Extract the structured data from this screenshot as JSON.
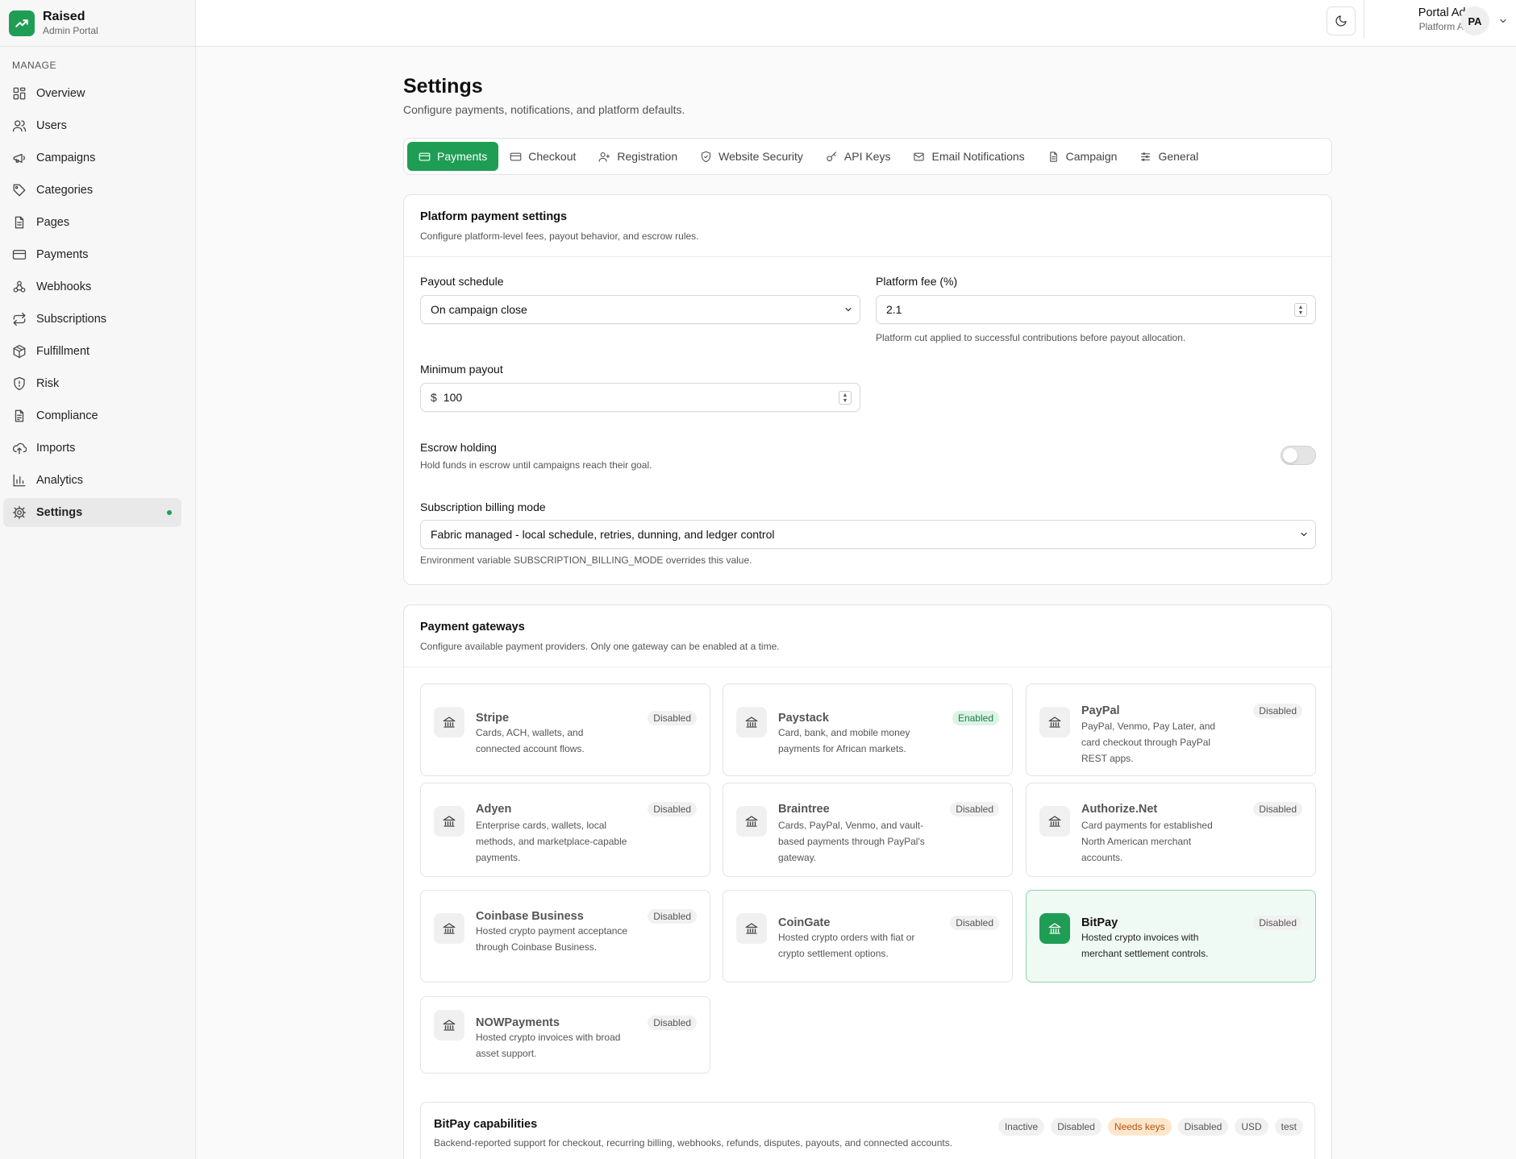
{
  "brand": {
    "name": "Raised",
    "subtitle": "Admin Portal"
  },
  "sidebar": {
    "section_label": "MANAGE",
    "items": [
      {
        "label": "Overview",
        "icon": "grid-icon"
      },
      {
        "label": "Users",
        "icon": "users-icon"
      },
      {
        "label": "Campaigns",
        "icon": "megaphone-icon"
      },
      {
        "label": "Categories",
        "icon": "tag-icon"
      },
      {
        "label": "Pages",
        "icon": "file-icon"
      },
      {
        "label": "Payments",
        "icon": "credit-card-icon"
      },
      {
        "label": "Webhooks",
        "icon": "webhook-icon"
      },
      {
        "label": "Subscriptions",
        "icon": "repeat-icon"
      },
      {
        "label": "Fulfillment",
        "icon": "package-icon"
      },
      {
        "label": "Risk",
        "icon": "shield-icon"
      },
      {
        "label": "Compliance",
        "icon": "document-icon"
      },
      {
        "label": "Imports",
        "icon": "cloud-upload-icon"
      },
      {
        "label": "Analytics",
        "icon": "bar-chart-icon"
      },
      {
        "label": "Settings",
        "icon": "gear-icon",
        "active": true
      }
    ]
  },
  "header": {
    "user_name": "Portal Admin",
    "user_role": "Platform Admin",
    "avatar_initials": "PA"
  },
  "page": {
    "title": "Settings",
    "subtitle": "Configure payments, notifications, and platform defaults."
  },
  "tabs": [
    {
      "label": "Payments",
      "active": true
    },
    {
      "label": "Checkout"
    },
    {
      "label": "Registration"
    },
    {
      "label": "Website Security"
    },
    {
      "label": "API Keys"
    },
    {
      "label": "Email Notifications"
    },
    {
      "label": "Campaign"
    },
    {
      "label": "General"
    }
  ],
  "platform": {
    "title": "Platform payment settings",
    "desc": "Configure platform-level fees, payout behavior, and escrow rules.",
    "payout_label": "Payout schedule",
    "payout_value": "On campaign close",
    "fee_label": "Platform fee (%)",
    "fee_value": "2.1",
    "fee_help": "Platform cut applied to successful contributions before payout allocation.",
    "min_label": "Minimum payout",
    "min_prefix": "$",
    "min_value": "100",
    "escrow_label": "Escrow holding",
    "escrow_help": "Hold funds in escrow until campaigns reach their goal.",
    "escrow_on": false,
    "billing_label": "Subscription billing mode",
    "billing_value": "Fabric managed - local schedule, retries, dunning, and ledger control",
    "billing_help": "Environment variable SUBSCRIPTION_BILLING_MODE overrides this value."
  },
  "gateways": {
    "title": "Payment gateways",
    "desc": "Configure available payment providers. Only one gateway can be enabled at a time.",
    "items": [
      {
        "name": "Stripe",
        "status": "Disabled",
        "desc": "Cards, ACH, wallets, and connected account flows."
      },
      {
        "name": "Paystack",
        "status": "Enabled",
        "desc": "Card, bank, and mobile money payments for African markets."
      },
      {
        "name": "PayPal",
        "status": "Disabled",
        "desc": "PayPal, Venmo, Pay Later, and card checkout through PayPal REST apps."
      },
      {
        "name": "Adyen",
        "status": "Disabled",
        "desc": "Enterprise cards, wallets, local methods, and marketplace-capable payments."
      },
      {
        "name": "Braintree",
        "status": "Disabled",
        "desc": "Cards, PayPal, Venmo, and vault-based payments through PayPal's gateway."
      },
      {
        "name": "Authorize.Net",
        "status": "Disabled",
        "desc": "Card payments for established North American merchant accounts."
      },
      {
        "name": "Coinbase Business",
        "status": "Disabled",
        "desc": "Hosted crypto payment acceptance through Coinbase Business."
      },
      {
        "name": "CoinGate",
        "status": "Disabled",
        "desc": "Hosted crypto orders with fiat or crypto settlement options."
      },
      {
        "name": "BitPay",
        "status": "Disabled",
        "desc": "Hosted crypto invoices with merchant settlement controls.",
        "selected": true
      },
      {
        "name": "NOWPayments",
        "status": "Disabled",
        "desc": "Hosted crypto invoices with broad asset support."
      }
    ]
  },
  "capabilities": {
    "title": "BitPay capabilities",
    "desc": "Backend-reported support for checkout, recurring billing, webhooks, refunds, disputes, payouts, and connected accounts.",
    "chips": [
      "Inactive",
      "Disabled",
      "Needs keys",
      "Disabled",
      "USD",
      "test"
    ]
  },
  "colors": {
    "accent": "#1f9d55",
    "warning": "#b45309"
  }
}
